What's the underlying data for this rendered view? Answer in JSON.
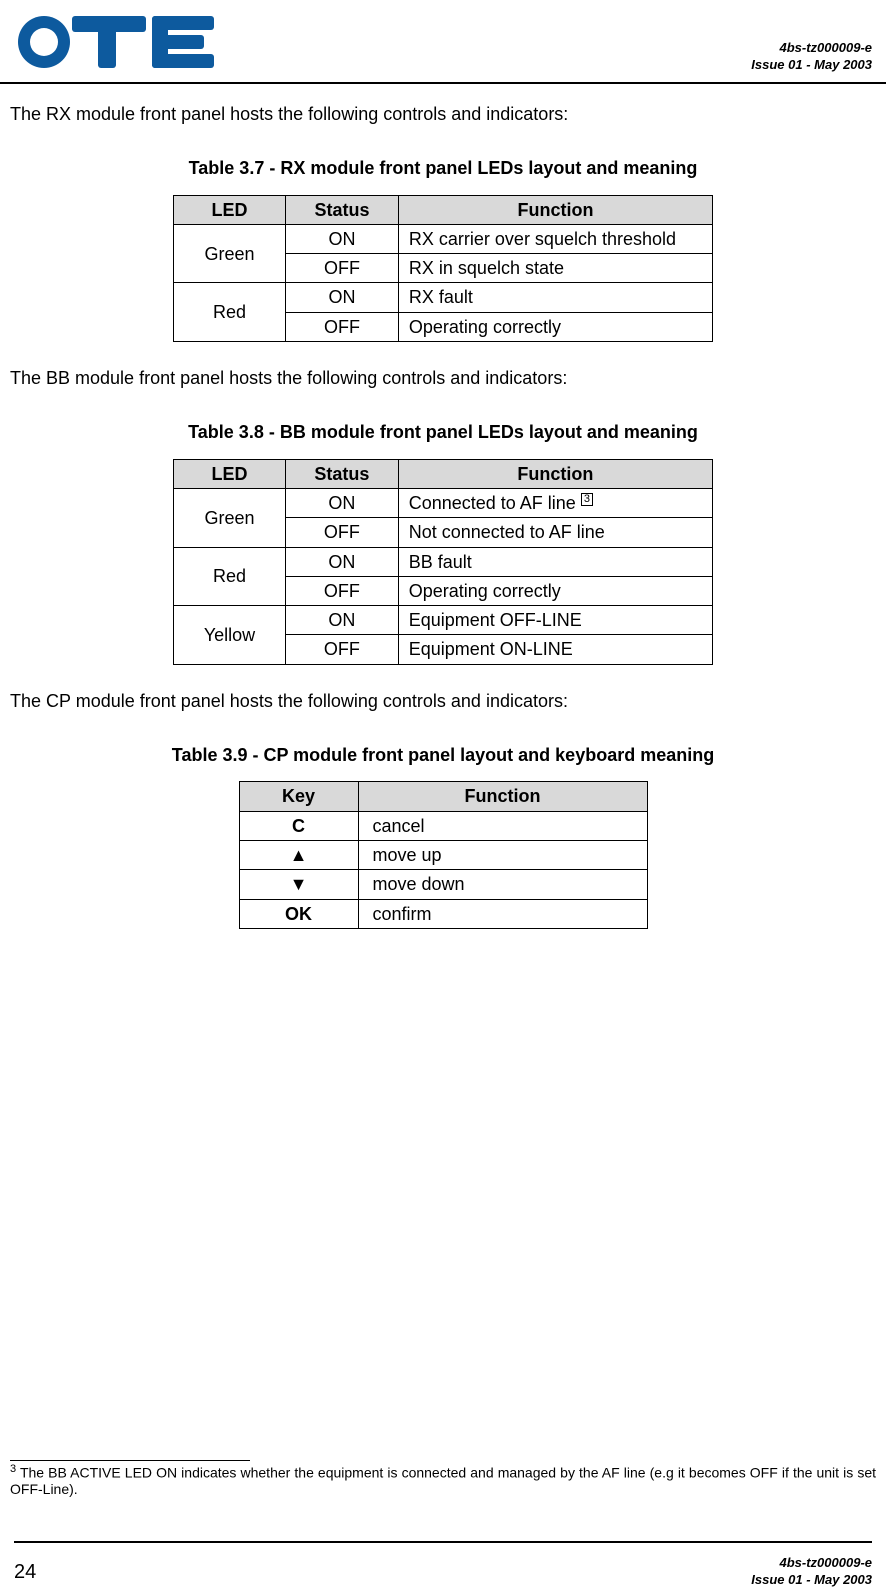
{
  "header": {
    "doc_id": "4bs-tz000009-e",
    "issue": "Issue 01 - May 2003"
  },
  "para1": "The RX module front panel hosts the following controls and indicators:",
  "table37": {
    "caption": "Table 3.7 - RX module front panel LEDs layout and meaning",
    "headers": {
      "led": "LED",
      "status": "Status",
      "function": "Function"
    },
    "rows": [
      {
        "led": "Green",
        "status": "ON",
        "function": "RX carrier over squelch threshold"
      },
      {
        "led_rowspan": true,
        "status": "OFF",
        "function": "RX in squelch state"
      },
      {
        "led": "Red",
        "status": "ON",
        "function": "RX fault"
      },
      {
        "led_rowspan": true,
        "status": "OFF",
        "function": "Operating correctly"
      }
    ]
  },
  "para2": "The BB module front panel hosts the following controls and indicators:",
  "table38": {
    "caption": "Table 3.8 - BB module front panel LEDs layout and meaning",
    "headers": {
      "led": "LED",
      "status": "Status",
      "function": "Function"
    },
    "rows": [
      {
        "led": "Green",
        "status": "ON",
        "function": "Connected to AF line ",
        "fn_ref": "3"
      },
      {
        "led_rowspan": true,
        "status": "OFF",
        "function": "Not connected to AF line"
      },
      {
        "led": "Red",
        "status": "ON",
        "function": "BB fault"
      },
      {
        "led_rowspan": true,
        "status": "OFF",
        "function": "Operating correctly"
      },
      {
        "led": "Yellow",
        "status": "ON",
        "function": "Equipment OFF-LINE"
      },
      {
        "led_rowspan": true,
        "status": "OFF",
        "function": "Equipment ON-LINE"
      }
    ]
  },
  "para3": "The CP module front panel hosts the following controls and indicators:",
  "table39": {
    "caption": "Table 3.9 - CP module front panel layout and keyboard meaning",
    "headers": {
      "key": "Key",
      "function": "Function"
    },
    "rows": [
      {
        "key": "C",
        "function": "cancel"
      },
      {
        "key": "▲",
        "function": "move up"
      },
      {
        "key": "▼",
        "function": "move down"
      },
      {
        "key": "OK",
        "function": "confirm"
      }
    ]
  },
  "footnote": {
    "marker": "3",
    "text": " The BB ACTIVE LED ON indicates whether the equipment is connected and managed by the AF line (e.g it becomes OFF if the unit is set OFF-Line)."
  },
  "footer": {
    "page_number": "24",
    "doc_id": "4bs-tz000009-e",
    "issue": "Issue 01 - May 2003"
  }
}
